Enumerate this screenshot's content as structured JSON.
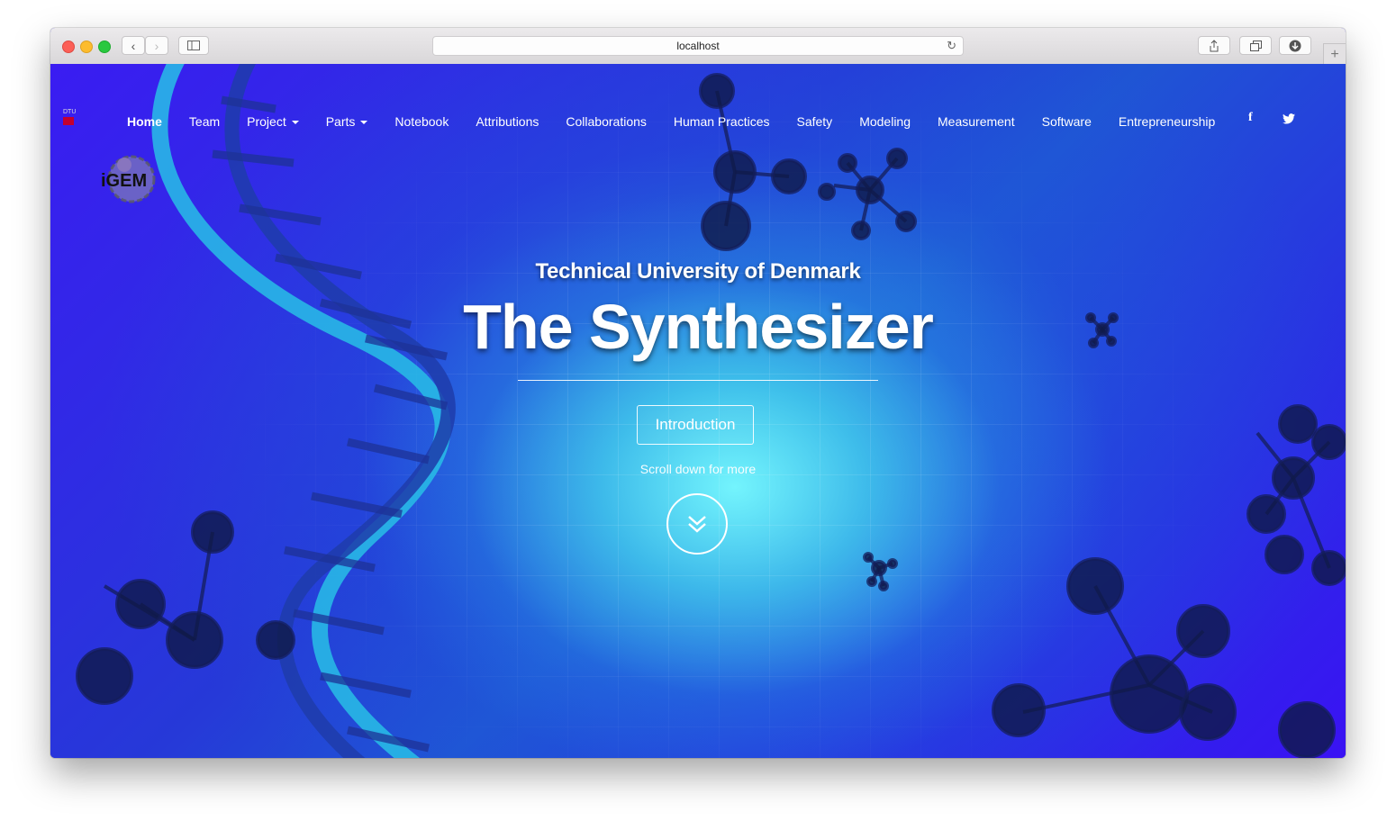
{
  "browser": {
    "url": "localhost"
  },
  "nav": {
    "items": [
      {
        "label": "Home",
        "active": true
      },
      {
        "label": "Team"
      },
      {
        "label": "Project",
        "dropdown": true
      },
      {
        "label": "Parts",
        "dropdown": true
      },
      {
        "label": "Notebook"
      },
      {
        "label": "Attributions"
      },
      {
        "label": "Collaborations"
      },
      {
        "label": "Human Practices"
      },
      {
        "label": "Safety"
      },
      {
        "label": "Modeling"
      },
      {
        "label": "Measurement"
      },
      {
        "label": "Software"
      },
      {
        "label": "Entrepreneurship"
      }
    ],
    "social": [
      {
        "icon": "facebook-icon",
        "glyph": "f"
      },
      {
        "icon": "twitter-icon",
        "glyph": "🐦"
      }
    ]
  },
  "brand": {
    "dtu_text": "DTU",
    "igem_text": "iGEM"
  },
  "hero": {
    "subtitle": "Technical University of Denmark",
    "title": "The Synthesizer",
    "intro_button": "Introduction",
    "scroll_text": "Scroll down for more"
  },
  "colors": {
    "accent": "#2a19e6",
    "glow": "#7afaff"
  }
}
